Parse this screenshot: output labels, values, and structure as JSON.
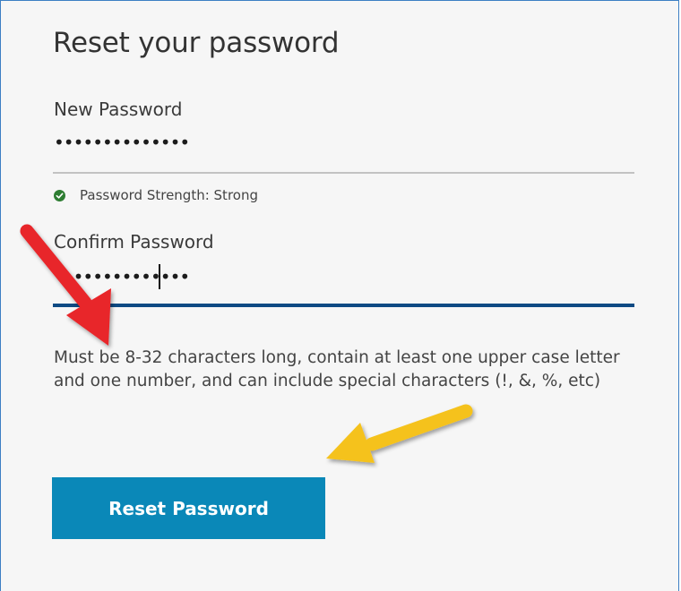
{
  "form": {
    "title": "Reset your password",
    "new_password": {
      "label": "New Password",
      "masked_value": "••••••••••••••"
    },
    "strength": {
      "text": "Password Strength: Strong",
      "status_color": "#2e7d32",
      "icon": "check-circle-icon"
    },
    "confirm_password": {
      "label": "Confirm Password",
      "masked_value": "••••••••••••••"
    },
    "hint": "Must be 8-32 characters long, contain at least one upper case letter and one number, and can include special characters (!, &, %, etc)",
    "submit_label": "Reset Password"
  },
  "annotations": {
    "arrow_red_color": "#e8262b",
    "arrow_yellow_color": "#f5c21b"
  },
  "colors": {
    "button": "#0a88b8",
    "focus_underline": "#0e4a83",
    "border": "#3d7fc4"
  }
}
